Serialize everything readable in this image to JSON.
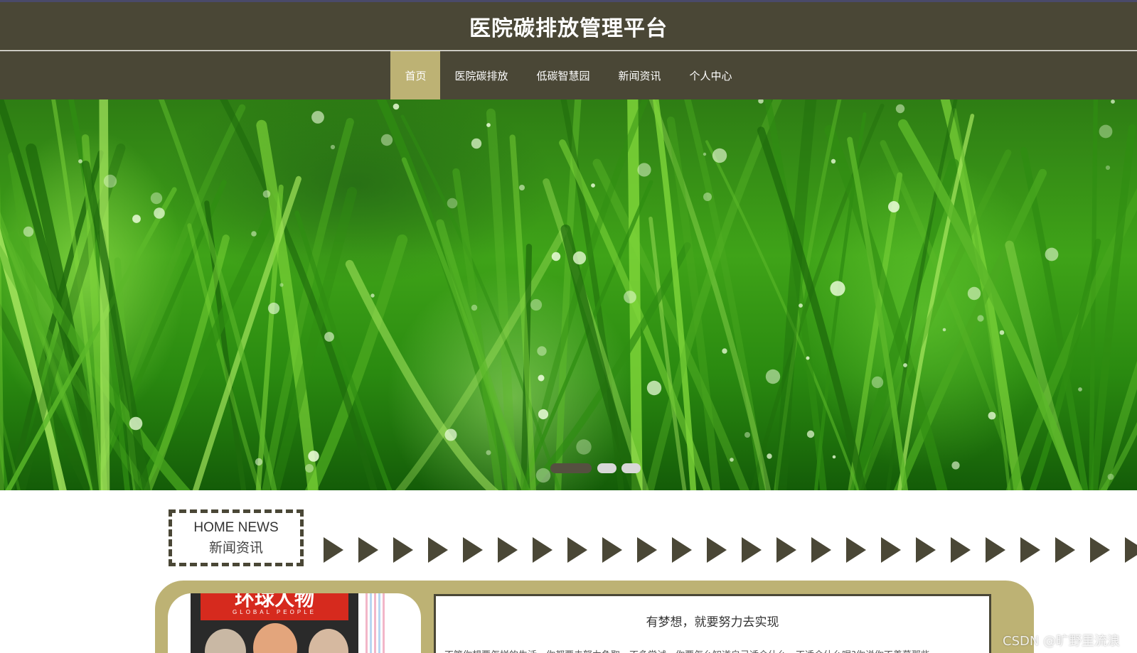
{
  "header": {
    "title": "医院碳排放管理平台"
  },
  "nav": {
    "items": [
      {
        "label": "首页",
        "active": true
      },
      {
        "label": "医院碳排放",
        "active": false
      },
      {
        "label": "低碳智慧园",
        "active": false
      },
      {
        "label": "新闻资讯",
        "active": false
      },
      {
        "label": "个人中心",
        "active": false
      }
    ],
    "active_color": "#bdb274",
    "bar_color": "#4a4736"
  },
  "banner": {
    "slide_count": 3,
    "active_slide": 1,
    "image": "green-grass-with-dew"
  },
  "news": {
    "label_en": "HOME NEWS",
    "label_cn": "新闻资讯",
    "arrow_icon": "play-triangle-icon",
    "featured": {
      "image_title": "环球人物",
      "image_subtitle": "GLOBAL PEOPLE",
      "headline": "有梦想，就要努力去实现",
      "excerpt": "不管你想要怎样的生活，你都要去努力争取，不多尝试，你要怎么知道自己适合什么，不适合什么呢?你说你不羡慕那些"
    }
  },
  "watermark": "CSDN @旷野里流浪"
}
